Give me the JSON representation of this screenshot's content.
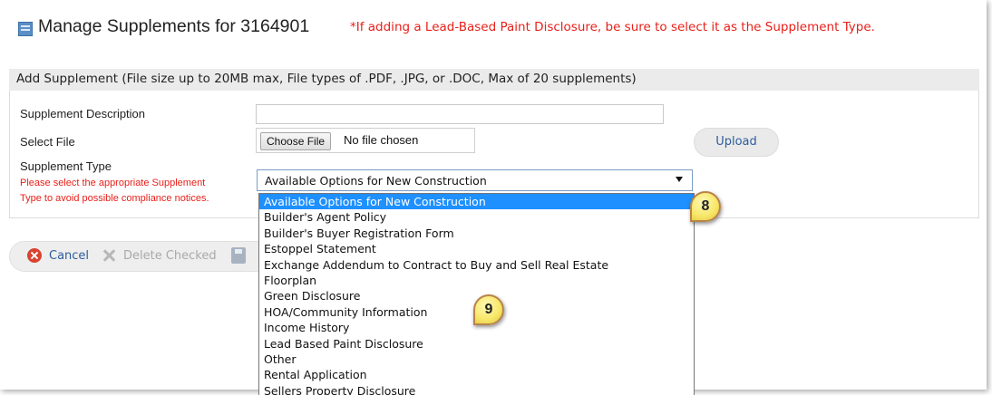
{
  "header": {
    "title": "Manage Supplements for 3164901",
    "note": "*If adding a Lead-Based Paint Disclosure, be sure to select it as the Supplement Type.",
    "icon": "list-icon"
  },
  "section": {
    "title": "Add Supplement (File size up to 20MB max, File types of .PDF, .JPG, or .DOC, Max of 20 supplements)"
  },
  "form": {
    "description_label": "Supplement Description",
    "description_value": "",
    "file_label": "Select File",
    "choose_file_label": "Choose File",
    "no_file_text": "No file chosen",
    "upload_label": "Upload",
    "type_label": "Supplement Type",
    "type_hint_line1": "Please select the appropriate Supplement",
    "type_hint_line2": "Type to avoid possible compliance notices.",
    "type_selected": "Available Options for New Construction",
    "type_options": [
      "Available Options for New Construction",
      "Builder's Agent Policy",
      "Builder's Buyer Registration Form",
      "Estoppel Statement",
      "Exchange Addendum to Contract to Buy and Sell Real Estate",
      "Floorplan",
      "Green Disclosure",
      "HOA/Community Information",
      "Income History",
      "Lead Based Paint Disclosure",
      "Other",
      "Rental Application",
      "Sellers Property Disclosure"
    ]
  },
  "toolbar": {
    "cancel_label": "Cancel",
    "delete_label": "Delete Checked"
  },
  "callouts": {
    "first": "8",
    "second": "9"
  },
  "colors": {
    "note_red": "#e8201a",
    "link_blue": "#2d5d9b",
    "selected_option": "#1e90ff"
  }
}
